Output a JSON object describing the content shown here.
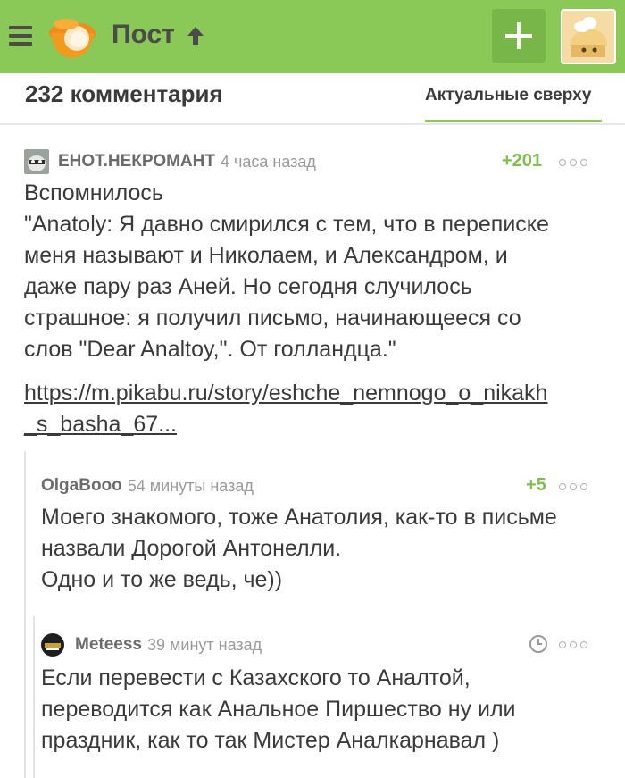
{
  "header": {
    "title": "Пост",
    "add_label": "+"
  },
  "subbar": {
    "comment_count": "232 комментария",
    "sort_label": "Актуальные сверху"
  },
  "comments": [
    {
      "user": "ЕНОТ.НЕКРОМАНТ",
      "time": "4 часа назад",
      "rating": "+201",
      "text": "Вспомнилось\n\"Anatoly: Я давно смирился с тем, что в переписке\nменя называют и Николаем, и Александром, и\nдаже пару раз Аней. Но сегодня случилось\nстрашное: я получил письмо, начинающееся со\nслов \"Dear Analtoy,\". От голландца.\"",
      "link_line1": "https://m.pikabu.ru/story/eshche_nemnogo_o_nikakh",
      "link_line2": "_s_basha_67..."
    },
    {
      "user": "OlgaBooo",
      "time": "54 минуты назад",
      "rating": "+5",
      "text": "Моего знакомого, тоже Анатолия, как-то в письме\nназвали Дорогой Антонелли.\nОдно и то же ведь, че))"
    },
    {
      "user": "Meteess",
      "time": "39 минут назад",
      "text": "Если перевести с Казахского то Аналтой,\nпереводится как Анальное Пиршество ну или\nпраздник, как то так Мистер Аналкарнавал )"
    }
  ]
}
